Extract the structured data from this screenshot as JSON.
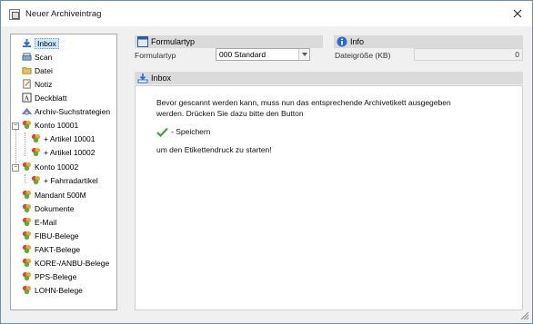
{
  "window": {
    "title": "Neuer Archiveintrag"
  },
  "tree": {
    "items": [
      {
        "label": "Inbox",
        "icon": "inbox-arrow-icon"
      },
      {
        "label": "Scan",
        "icon": "scanner-icon"
      },
      {
        "label": "Datei",
        "icon": "folder-icon"
      },
      {
        "label": "Notiz",
        "icon": "note-icon"
      },
      {
        "label": "Deckblatt",
        "icon": "cover-sheet-icon"
      },
      {
        "label": "Archiv-Suchstrategien",
        "icon": "search-strategy-icon"
      },
      {
        "label": "Konto 10001",
        "icon": "archive-hearts-icon"
      },
      {
        "label": "+ Artikel 10001",
        "icon": "archive-hearts-icon"
      },
      {
        "label": "+ Artikel 10002",
        "icon": "archive-hearts-icon"
      },
      {
        "label": "Konto 10002",
        "icon": "archive-hearts-icon"
      },
      {
        "label": "+ Fahrradartikel",
        "icon": "archive-hearts-icon"
      },
      {
        "label": "Mandant 500M",
        "icon": "archive-hearts-icon"
      },
      {
        "label": "Dokumente",
        "icon": "archive-hearts-icon"
      },
      {
        "label": "E-Mail",
        "icon": "archive-hearts-icon"
      },
      {
        "label": "FIBU-Belege",
        "icon": "archive-hearts-icon"
      },
      {
        "label": "FAKT-Belege",
        "icon": "archive-hearts-icon"
      },
      {
        "label": "KORE-/ANBU-Belege",
        "icon": "archive-hearts-icon"
      },
      {
        "label": "PPS-Belege",
        "icon": "archive-hearts-icon"
      },
      {
        "label": "LOHN-Belege",
        "icon": "archive-hearts-icon"
      }
    ]
  },
  "formulartyp": {
    "header": "Formulartyp",
    "label": "Formulartyp",
    "value": "000 Standard"
  },
  "info": {
    "header": "Info",
    "size_label": "Dateigröße (KB)",
    "size_value": "0"
  },
  "inbox": {
    "header": "Inbox",
    "line1": "Bevor gescannt werden kann, muss nun das entsprechende Archivetikett ausgegeben",
    "line2": "werden. Drücken Sie dazu bitte den Button",
    "save_label": "- Speichern",
    "line3": "um den Etikettendruck zu starten!"
  },
  "colors": {
    "selection": "#cde8ff",
    "header_bg": "#dadada",
    "border_blue": "#6a8fb6"
  }
}
